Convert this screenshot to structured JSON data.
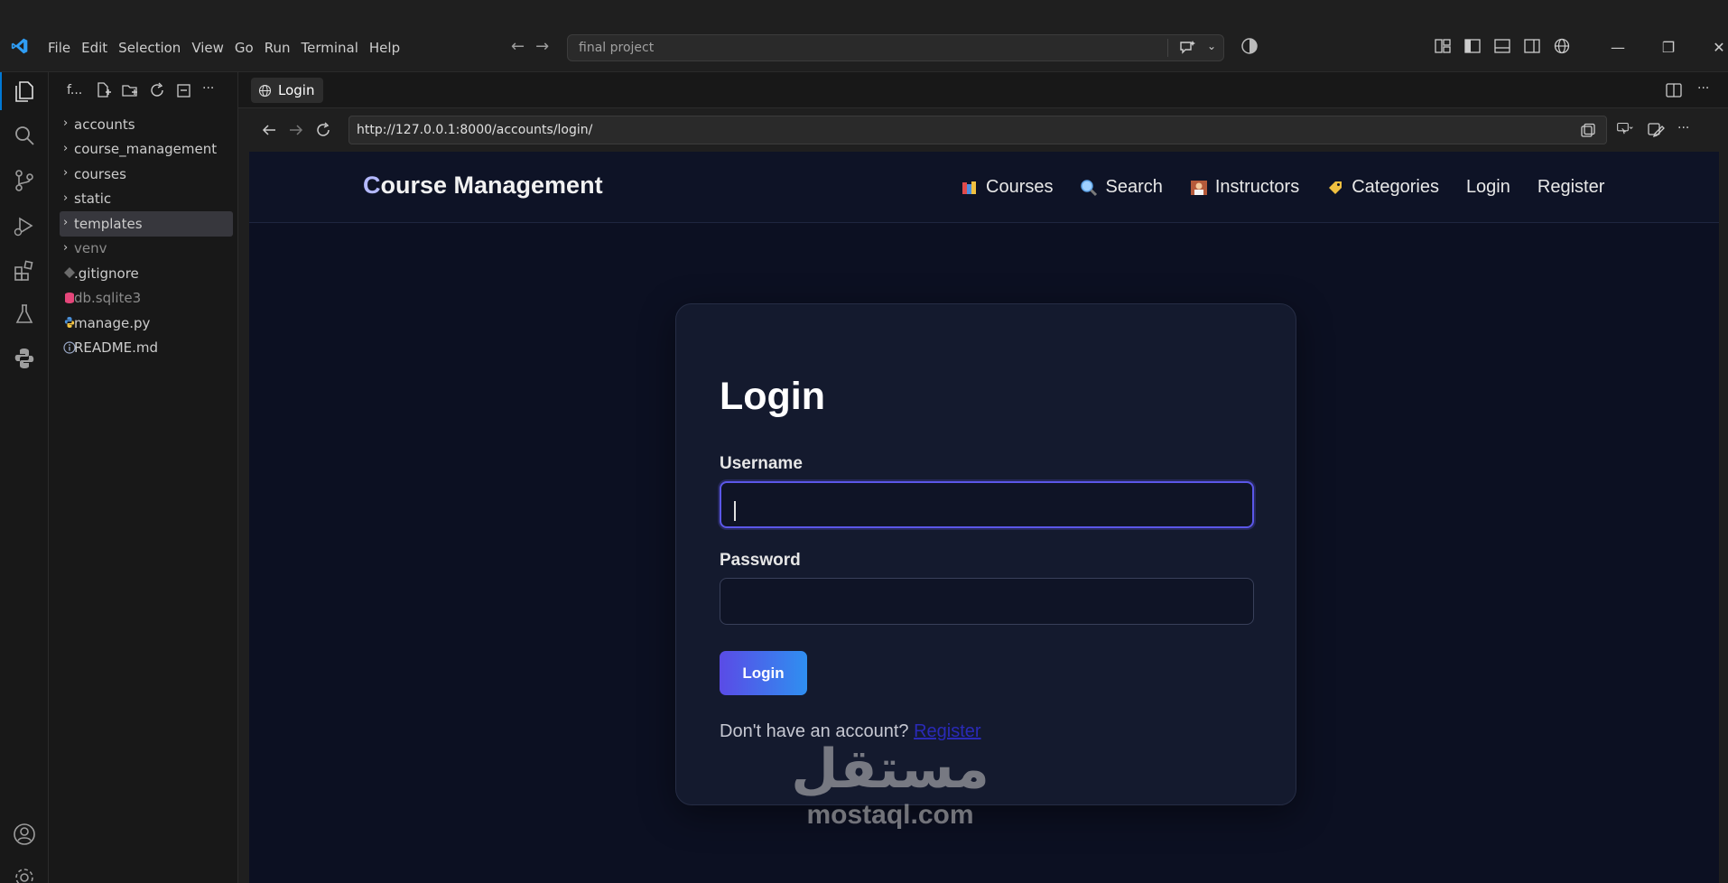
{
  "menu": [
    "File",
    "Edit",
    "Selection",
    "View",
    "Go",
    "Run",
    "Terminal",
    "Help"
  ],
  "command_center": {
    "text": "final project"
  },
  "explorer": {
    "title": "f...",
    "items": [
      {
        "label": "accounts",
        "kind": "folder"
      },
      {
        "label": "course_management",
        "kind": "folder"
      },
      {
        "label": "courses",
        "kind": "folder"
      },
      {
        "label": "static",
        "kind": "folder"
      },
      {
        "label": "templates",
        "kind": "folder",
        "selected": true
      },
      {
        "label": "venv",
        "kind": "folder",
        "dim": true
      },
      {
        "label": ".gitignore",
        "kind": "file",
        "icon": "git-diamond-icon"
      },
      {
        "label": "db.sqlite3",
        "kind": "file",
        "icon": "database-icon",
        "dim": true
      },
      {
        "label": "manage.py",
        "kind": "file",
        "icon": "python-icon"
      },
      {
        "label": "README.md",
        "kind": "file",
        "icon": "info-icon"
      }
    ]
  },
  "editor": {
    "tab_label": "Login",
    "url": "http://127.0.0.1:8000/accounts/login/"
  },
  "site": {
    "brand_first": "C",
    "brand_rest": "ourse Management",
    "nav": [
      {
        "label": "Courses",
        "icon": "books-icon"
      },
      {
        "label": "Search",
        "icon": "magnifier-icon"
      },
      {
        "label": "Instructors",
        "icon": "teacher-icon"
      },
      {
        "label": "Categories",
        "icon": "tag-icon"
      },
      {
        "label": "Login",
        "icon": ""
      },
      {
        "label": "Register",
        "icon": ""
      }
    ],
    "login": {
      "title": "Login",
      "username_label": "Username",
      "username_value": "",
      "password_label": "Password",
      "password_value": "",
      "button": "Login",
      "register_prompt": "Don't have an account?",
      "register_link": "Register"
    },
    "watermark": {
      "arabic": "مستقل",
      "latin": "mostaql.com"
    }
  },
  "colors": {
    "accent": "#0078d4",
    "page_bg": "#0c1022",
    "card_bg": "#141a2e",
    "button_start": "#5a4be6",
    "button_end": "#2f8ff0"
  }
}
